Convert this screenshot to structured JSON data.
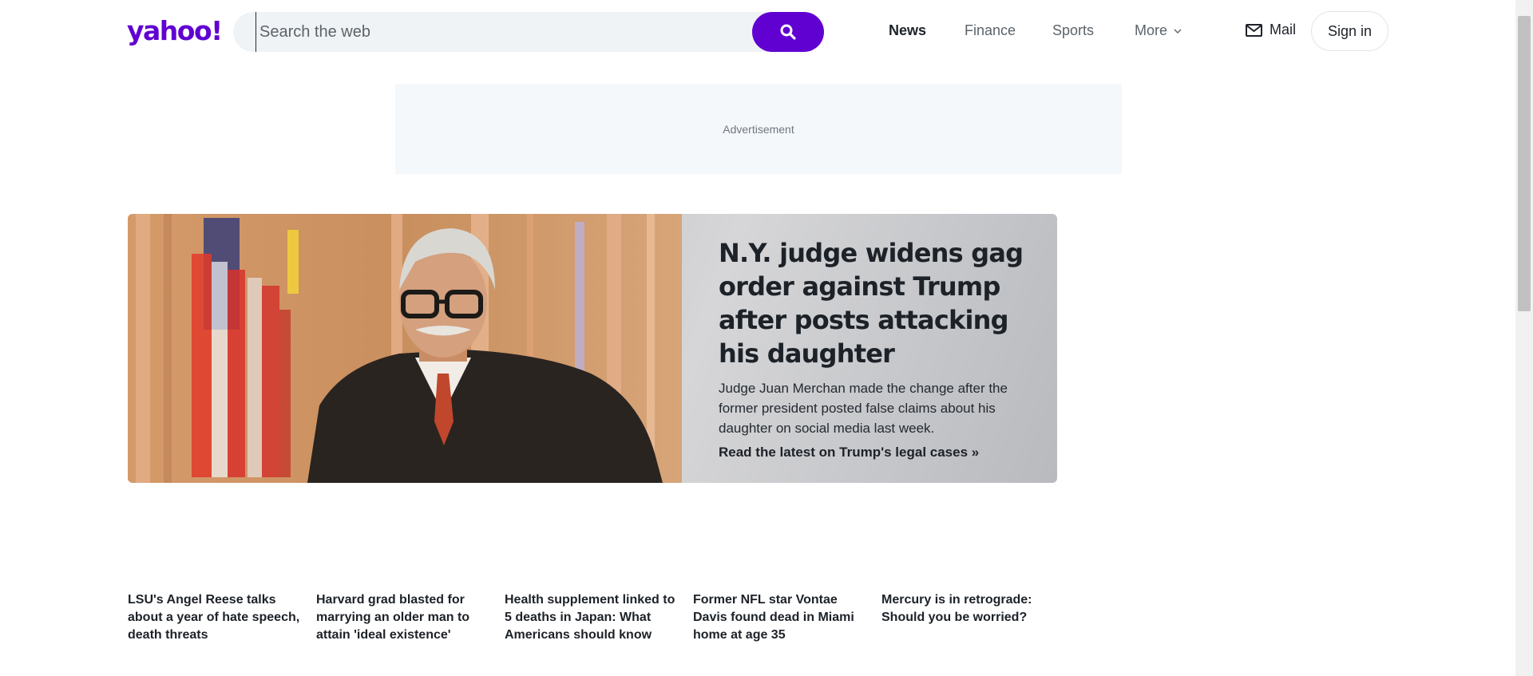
{
  "header": {
    "logo_text": "yahoo!",
    "search": {
      "placeholder": "Search the web",
      "value": ""
    },
    "nav": [
      {
        "label": "News",
        "active": true
      },
      {
        "label": "Finance",
        "active": false
      },
      {
        "label": "Sports",
        "active": false
      },
      {
        "label": "More",
        "active": false
      }
    ],
    "mail_label": "Mail",
    "signin_label": "Sign in"
  },
  "ad": {
    "label": "Advertisement"
  },
  "hero": {
    "headline": "N.Y. judge widens gag order against Trump after posts attacking his daughter",
    "summary": "Judge Juan Merchan made the change after the former president posted false claims about his daughter on social media last week.",
    "link": "Read the latest on Trump's legal cases »"
  },
  "stories": [
    {
      "title": "LSU's Angel Reese talks about a year of hate speech, death threats"
    },
    {
      "title": "Harvard grad blasted for marrying an older man to attain 'ideal existence'"
    },
    {
      "title": "Health supplement linked to 5 deaths in Japan: What Americans should know"
    },
    {
      "title": "Former NFL star Vontae Davis found dead in Miami home at age 35"
    },
    {
      "title": "Mercury is in retrograde: Should you be worried?"
    }
  ],
  "colors": {
    "brand": "#6001d2",
    "text": "#1d2228",
    "muted": "#5b636a",
    "search_bg": "#f0f3f5",
    "ad_bg": "#f5f8fa"
  },
  "icons": {
    "search": "search-icon",
    "mail": "mail-icon",
    "more": "chevron-down-icon"
  }
}
